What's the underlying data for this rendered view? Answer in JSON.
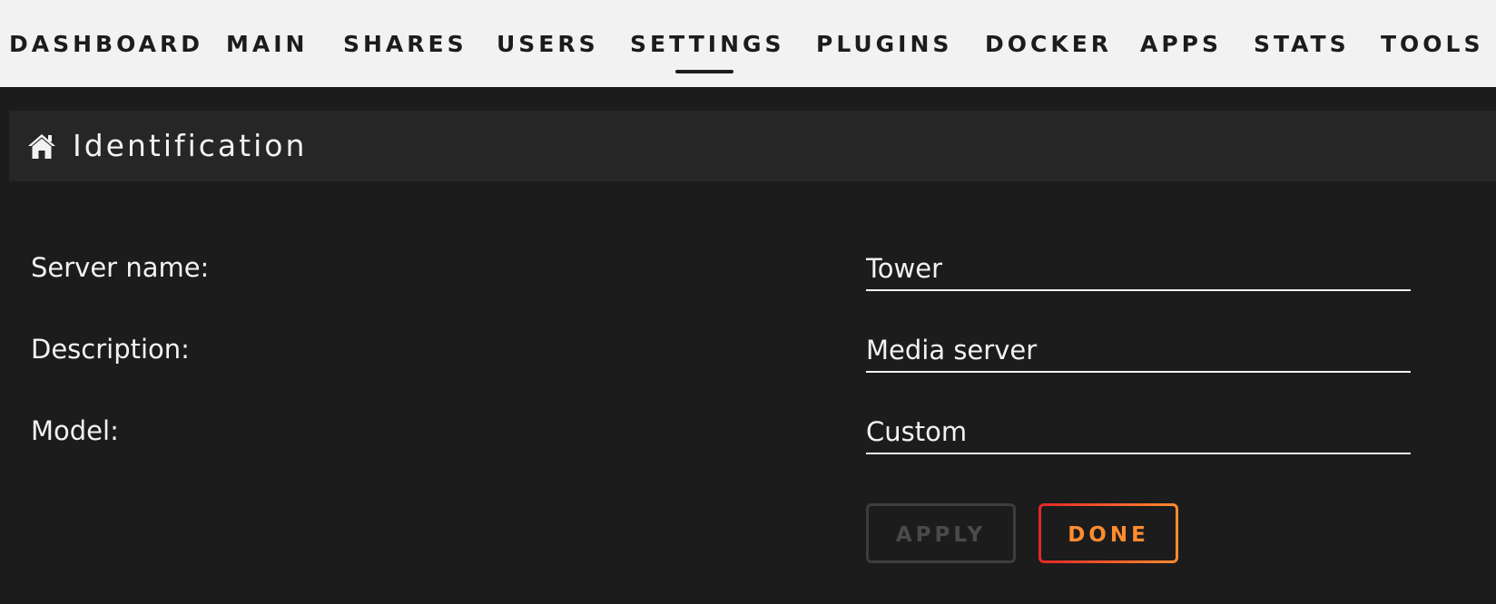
{
  "nav": {
    "items": [
      {
        "label": "DASHBOARD"
      },
      {
        "label": "MAIN"
      },
      {
        "label": "SHARES"
      },
      {
        "label": "USERS"
      },
      {
        "label": "SETTINGS",
        "active": true
      },
      {
        "label": "PLUGINS"
      },
      {
        "label": "DOCKER"
      },
      {
        "label": "APPS"
      },
      {
        "label": "STATS"
      },
      {
        "label": "TOOLS"
      }
    ]
  },
  "section": {
    "icon": "home-icon",
    "title": "Identification"
  },
  "form": {
    "server_name": {
      "label": "Server name:",
      "value": "Tower"
    },
    "description": {
      "label": "Description:",
      "value": "Media server"
    },
    "model": {
      "label": "Model:",
      "value": "Custom"
    }
  },
  "buttons": {
    "apply_label": "APPLY",
    "done_label": "DONE"
  },
  "colors": {
    "nav_background": "#f2f2f2",
    "page_background": "#1c1c1c",
    "section_header_background": "#262626",
    "text_light": "#f2f2f2",
    "text_dark": "#1c1c1c",
    "accent_orange": "#ff8c2f",
    "accent_red": "#e22828",
    "disabled": "#3d3d3d"
  }
}
